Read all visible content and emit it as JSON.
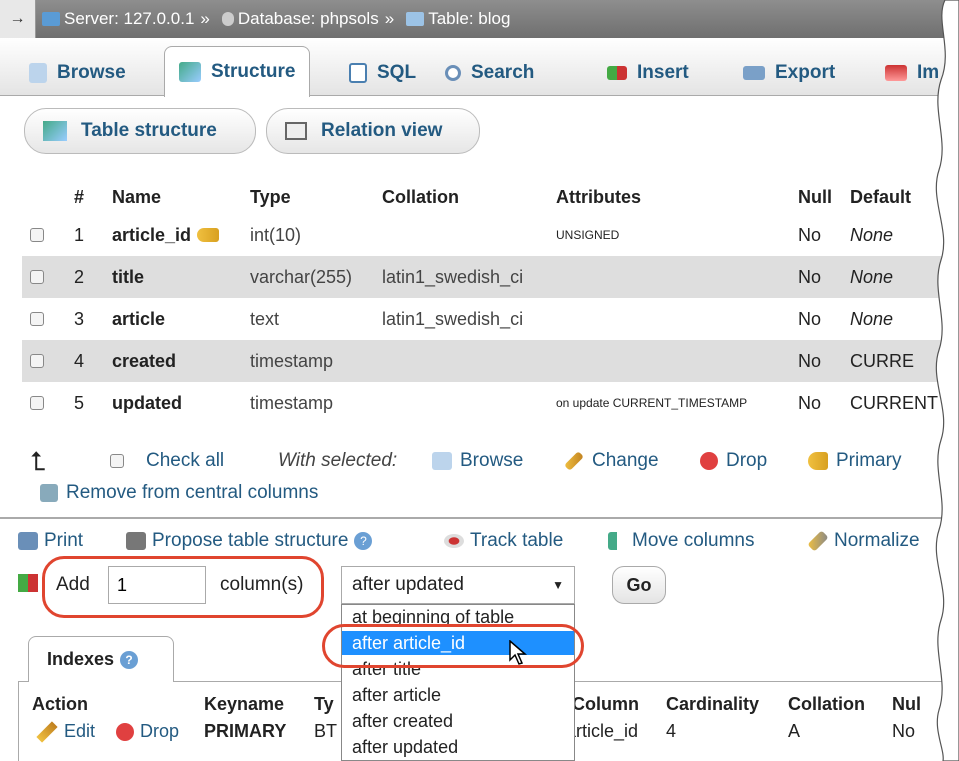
{
  "breadcrumb": {
    "arrow": "→",
    "server": "Server: 127.0.0.1",
    "sep": "»",
    "database": "Database: phpsols",
    "table": "Table: blog"
  },
  "tabs": [
    {
      "label": "Browse",
      "icon": "browse-icon"
    },
    {
      "label": "Structure",
      "icon": "structure-icon",
      "active": true
    },
    {
      "label": "SQL",
      "icon": "sql-icon"
    },
    {
      "label": "Search",
      "icon": "search-icon"
    },
    {
      "label": "Insert",
      "icon": "insert-icon"
    },
    {
      "label": "Export",
      "icon": "export-icon"
    },
    {
      "label": "Im",
      "icon": "import-icon"
    }
  ],
  "subtabs": {
    "table_structure": "Table structure",
    "relation_view": "Relation view"
  },
  "structure": {
    "headers": [
      "#",
      "Name",
      "Type",
      "Collation",
      "Attributes",
      "Null",
      "Default"
    ],
    "rows": [
      {
        "num": "1",
        "name": "article_id",
        "type": "int(10)",
        "collation": "",
        "attributes": "UNSIGNED",
        "null": "No",
        "default": "None",
        "primary": true
      },
      {
        "num": "2",
        "name": "title",
        "type": "varchar(255)",
        "collation": "latin1_swedish_ci",
        "attributes": "",
        "null": "No",
        "default": "None"
      },
      {
        "num": "3",
        "name": "article",
        "type": "text",
        "collation": "latin1_swedish_ci",
        "attributes": "",
        "null": "No",
        "default": "None"
      },
      {
        "num": "4",
        "name": "created",
        "type": "timestamp",
        "collation": "",
        "attributes": "",
        "null": "No",
        "default": "CURRE"
      },
      {
        "num": "5",
        "name": "updated",
        "type": "timestamp",
        "collation": "",
        "attributes": "on update CURRENT_TIMESTAMP",
        "null": "No",
        "default": "CURRENT"
      }
    ]
  },
  "bulk": {
    "check_all": "Check all",
    "with_selected": "With selected:",
    "browse": "Browse",
    "change": "Change",
    "drop": "Drop",
    "primary": "Primary",
    "remove_central": "Remove from central columns"
  },
  "tools": {
    "print": "Print",
    "propose": "Propose table structure",
    "track": "Track table",
    "move": "Move columns",
    "normalize": "Normalize"
  },
  "add_column": {
    "label": "Add",
    "count": "1",
    "unit": "column(s)",
    "position_selected": "after updated",
    "options": [
      "at beginning of table",
      "after article_id",
      "after title",
      "after article",
      "after created",
      "after updated"
    ],
    "highlighted": "after article_id",
    "go": "Go"
  },
  "indexes": {
    "tab": "Indexes",
    "headers": {
      "action": "Action",
      "keyname": "Keyname",
      "type": "Ty",
      "column": "Column",
      "cardinality": "Cardinality",
      "collation": "Collation",
      "null": "Nul"
    },
    "row": {
      "edit": "Edit",
      "drop": "Drop",
      "keyname": "PRIMARY",
      "type": "BT",
      "column": "article_id",
      "cardinality": "4",
      "collation": "A",
      "null": "No"
    }
  },
  "colors": {
    "link": "#235a81",
    "highlight": "#1e90ff",
    "annotation": "#e0452f",
    "row_alt": "#dedede"
  }
}
